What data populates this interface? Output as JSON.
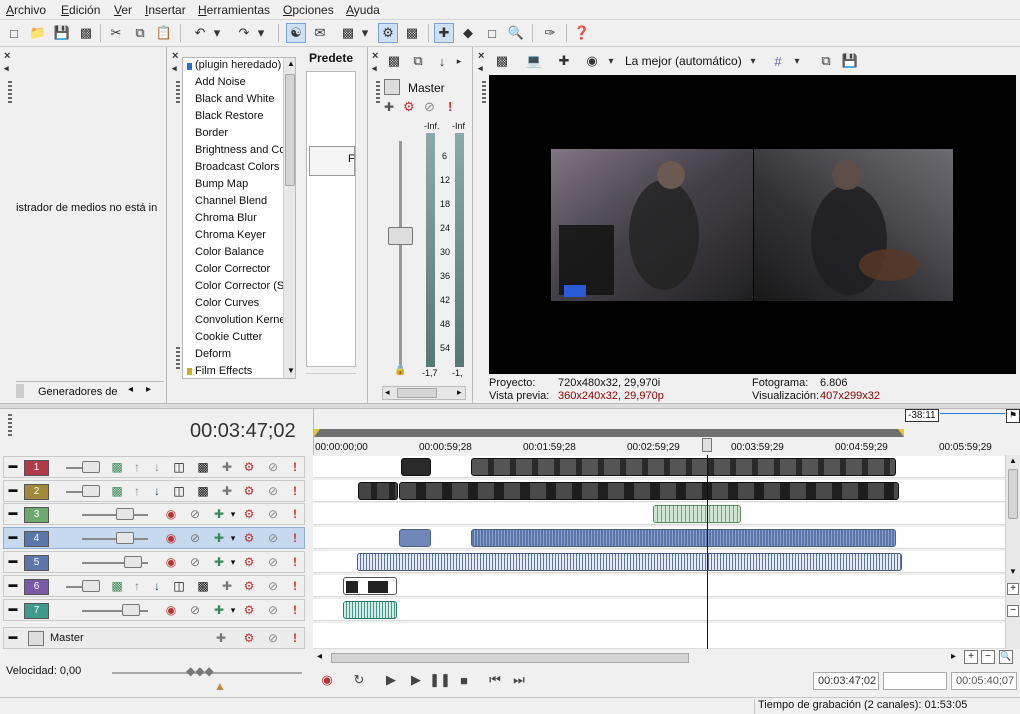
{
  "menu": {
    "items": [
      "Archivo",
      "Edición",
      "Ver",
      "Insertar",
      "Herramientas",
      "Opciones",
      "Ayuda"
    ]
  },
  "media_panel": {
    "message": "istrador de medios no está in",
    "tab_label": "Generadores de"
  },
  "effects": {
    "items": [
      "(plugin heredado)",
      "Add Noise",
      "Black and White",
      "Black Restore",
      "Border",
      "Brightness and Co",
      "Broadcast Colors",
      "Bump Map",
      "Channel Blend",
      "Chroma Blur",
      "Chroma Keyer",
      "Color Balance",
      "Color Corrector",
      "Color Corrector (S",
      "Color Curves",
      "Convolution Kerne",
      "Cookie Cutter",
      "Deform",
      "Film Effects"
    ],
    "presets_label": "Predete",
    "preset_item": "F"
  },
  "master_bus": {
    "title": "Master",
    "scale": [
      "-Inf.",
      "-Inf",
      "6",
      "12",
      "18",
      "24",
      "30",
      "36",
      "42",
      "48",
      "54"
    ],
    "peak_left": "-1,7",
    "peak_right": "-1,"
  },
  "preview": {
    "quality": "La mejor (automático)",
    "project_label": "Proyecto:",
    "project_value": "720x480x32, 29,970i",
    "preview_label": "Vista previa:",
    "preview_value": "360x240x32, 29,970p",
    "frame_label": "Fotograma:",
    "frame_value": "6.806",
    "display_label": "Visualización:",
    "display_value": "407x299x32"
  },
  "timeline": {
    "current_time": "00:03:47;02",
    "region_marker": "-38:11",
    "ruler": [
      "00:00:00;00",
      "00:00:59;28",
      "00:01:59;28",
      "00:02:59;29",
      "00:03:59;29",
      "00:04:59;29",
      "00:05:59;29"
    ],
    "tracks": [
      {
        "num": "1",
        "type": "video",
        "color": "#b03a48"
      },
      {
        "num": "2",
        "type": "video",
        "color": "#a08a3a"
      },
      {
        "num": "3",
        "type": "audio",
        "color": "#6fa86f"
      },
      {
        "num": "4",
        "type": "audio",
        "color": "#5b76a8"
      },
      {
        "num": "5",
        "type": "audio",
        "color": "#5b76a8"
      },
      {
        "num": "6",
        "type": "video",
        "color": "#7a5aa8"
      },
      {
        "num": "7",
        "type": "audio",
        "color": "#3e9a8a"
      }
    ],
    "master_label": "Master"
  },
  "transport": {
    "speed_label": "Velocidad: 0,00",
    "position": "00:03:47;02",
    "end_time": "00:05:40;07"
  },
  "status": {
    "record_time": "Tiempo de grabación (2 canales): 01:53:05"
  },
  "colors": {
    "accent": "#c6d9ef",
    "red_value": "#8b0000"
  }
}
